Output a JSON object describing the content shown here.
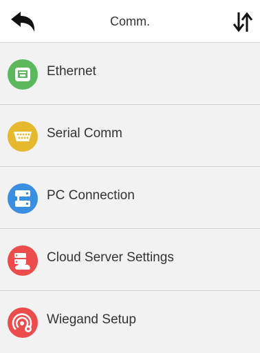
{
  "header": {
    "title": "Comm.",
    "back_icon": "back-arrow-icon",
    "sort_icon": "sort-arrows-icon"
  },
  "menu": {
    "items": [
      {
        "label": "Ethernet",
        "icon": "ethernet-icon",
        "color": "#5cb85c"
      },
      {
        "label": "Serial Comm",
        "icon": "serial-port-icon",
        "color": "#e6b82e"
      },
      {
        "label": "PC Connection",
        "icon": "pc-connection-icon",
        "color": "#3a8fe0"
      },
      {
        "label": "Cloud Server Settings",
        "icon": "cloud-server-icon",
        "color": "#ec4c4c"
      },
      {
        "label": "Wiegand Setup",
        "icon": "wiegand-icon",
        "color": "#ec4c4c"
      }
    ]
  }
}
